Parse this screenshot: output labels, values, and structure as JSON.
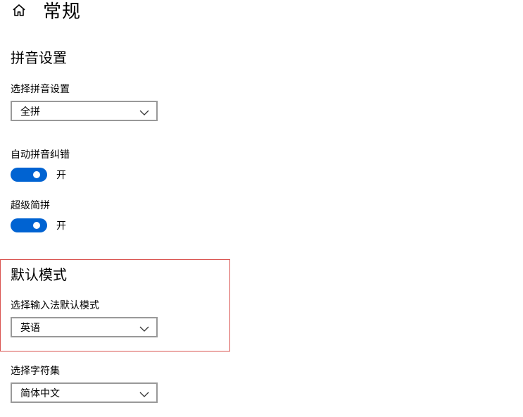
{
  "header": {
    "home_icon": "home-icon",
    "title": "常规"
  },
  "pinyin_settings": {
    "section_title": "拼音设置",
    "select_pinyin": {
      "label": "选择拼音设置",
      "value": "全拼"
    },
    "auto_correction": {
      "label": "自动拼音纠错",
      "state": "开",
      "on": true
    },
    "super_abbrev": {
      "label": "超级简拼",
      "state": "开",
      "on": true
    }
  },
  "default_mode": {
    "section_title": "默认模式",
    "select_mode": {
      "label": "选择输入法默认模式",
      "value": "英语"
    }
  },
  "charset": {
    "label": "选择字符集",
    "value": "简体中文"
  },
  "colors": {
    "toggle_on": "#0063d2",
    "highlight_border": "#d9534f"
  }
}
